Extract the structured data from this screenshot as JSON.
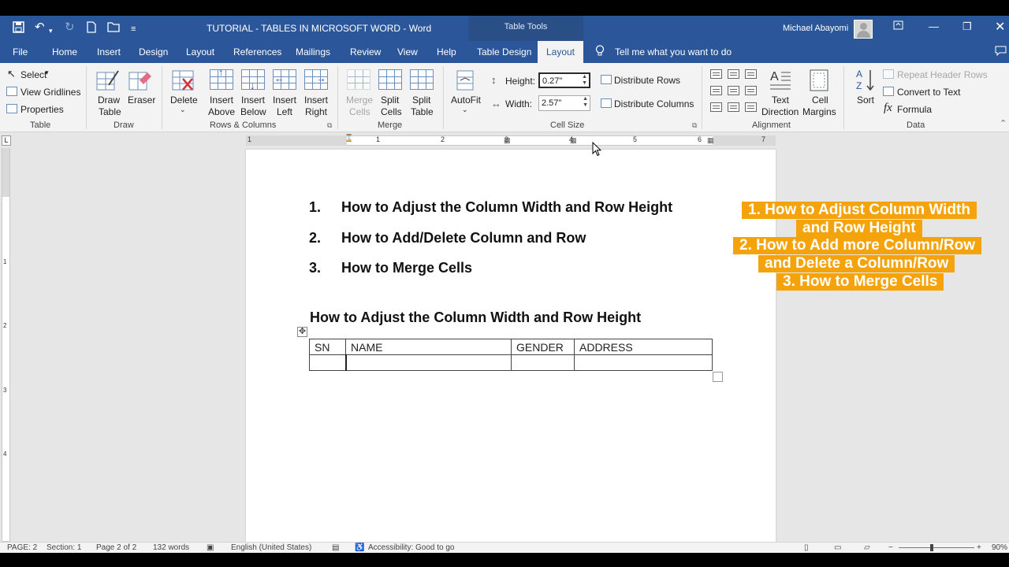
{
  "window": {
    "title": "TUTORIAL - TABLES IN MICROSOFT WORD  -  Word",
    "context_tab_group": "Table Tools",
    "user": "Michael Abayomi"
  },
  "tabs": [
    {
      "label": "File"
    },
    {
      "label": "Home"
    },
    {
      "label": "Insert"
    },
    {
      "label": "Design"
    },
    {
      "label": "Layout"
    },
    {
      "label": "References"
    },
    {
      "label": "Mailings"
    },
    {
      "label": "Review"
    },
    {
      "label": "View"
    },
    {
      "label": "Help"
    },
    {
      "label": "Table Design"
    },
    {
      "label": "Layout",
      "active": true
    }
  ],
  "tell_me": "Tell me what you want to do",
  "ribbon": {
    "table_group": {
      "select": "Select",
      "view_gridlines": "View Gridlines",
      "properties": "Properties",
      "label": "Table"
    },
    "draw_group": {
      "draw_table_1": "Draw",
      "draw_table_2": "Table",
      "eraser": "Eraser",
      "label": "Draw"
    },
    "rows_group": {
      "delete": "Delete",
      "insert_above_1": "Insert",
      "insert_above_2": "Above",
      "insert_below_1": "Insert",
      "insert_below_2": "Below",
      "insert_left_1": "Insert",
      "insert_left_2": "Left",
      "insert_right_1": "Insert",
      "insert_right_2": "Right",
      "label": "Rows & Columns"
    },
    "merge_group": {
      "merge_1": "Merge",
      "merge_2": "Cells",
      "split_cells_1": "Split",
      "split_cells_2": "Cells",
      "split_table_1": "Split",
      "split_table_2": "Table",
      "label": "Merge"
    },
    "cell_size_group": {
      "autofit": "AutoFit",
      "height_label": "Height:",
      "height_value": "0.27\"",
      "width_label": "Width:",
      "width_value": "2.57\"",
      "distribute_rows": "Distribute Rows",
      "distribute_columns": "Distribute Columns",
      "label": "Cell Size"
    },
    "alignment_group": {
      "text_direction_1": "Text",
      "text_direction_2": "Direction",
      "cell_margins_1": "Cell",
      "cell_margins_2": "Margins",
      "label": "Alignment"
    },
    "data_group": {
      "sort": "Sort",
      "repeat_header": "Repeat Header Rows",
      "convert_to_text": "Convert to Text",
      "formula": "Formula",
      "label": "Data"
    }
  },
  "ruler": {
    "h_numbers": [
      "1",
      "1",
      "2",
      "3",
      "4",
      "5",
      "6",
      "7"
    ],
    "v_numbers": [
      "1",
      "2",
      "3",
      "4"
    ]
  },
  "document": {
    "list": [
      {
        "num": "1.",
        "text": "How to Adjust the Column Width and Row Height"
      },
      {
        "num": "2.",
        "text": "How to Add/Delete Column and Row"
      },
      {
        "num": "3.",
        "text": "How to Merge Cells"
      }
    ],
    "heading": "How to Adjust the Column Width and Row Height",
    "table": {
      "headers": [
        "SN",
        "NAME",
        "GENDER",
        "ADDRESS"
      ],
      "rows": [
        [
          "",
          "",
          "",
          ""
        ]
      ]
    }
  },
  "callout": {
    "lines": [
      "1. How to Adjust Column Width",
      "and Row Height",
      "2. How to Add more Column/Row",
      "and Delete a Column/Row",
      "3. How to Merge Cells"
    ],
    "color": "#f5a30a"
  },
  "status": {
    "page": "PAGE: 2",
    "section": "Section: 1",
    "page_of": "Page 2 of 2",
    "words": "132 words",
    "language": "English (United States)",
    "accessibility": "Accessibility: Good to go",
    "zoom": "90%"
  },
  "colors": {
    "word_blue": "#2b579a",
    "ribbon_bg": "#f3f3f3"
  }
}
